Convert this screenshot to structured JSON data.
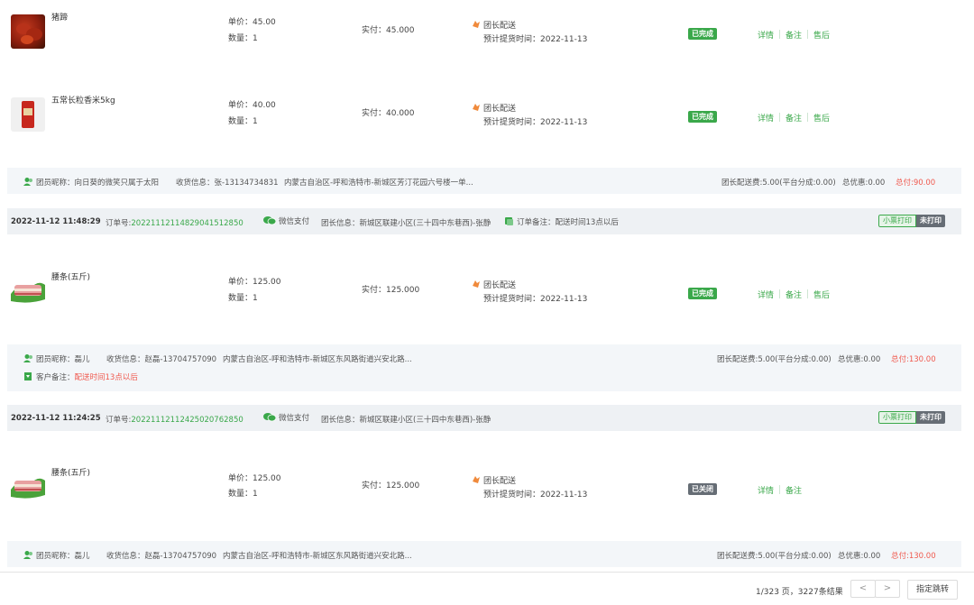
{
  "orders_top": {
    "items": [
      {
        "name": "猪蹄",
        "price": "单价：45.00",
        "qty": "数量：1",
        "paid": "实付：45.000",
        "delivery": "团长配送",
        "pickup": "预计提货时间：2022-11-13",
        "status": "已完成",
        "actions": [
          "详情",
          "备注",
          "售后"
        ]
      },
      {
        "name": "五常长粒香米5kg",
        "price": "单价：40.00",
        "qty": "数量：1",
        "paid": "实付：40.000",
        "delivery": "团长配送",
        "pickup": "预计提货时间：2022-11-13",
        "status": "已完成",
        "actions": [
          "详情",
          "备注",
          "售后"
        ]
      }
    ],
    "summary": {
      "member": "团员昵称：向日葵的微笑只属于太阳",
      "receive": "收货信息：张-13134734831",
      "address": "内蒙古自治区-呼和浩特市-新城区芳汀花园六号楼一单...",
      "fee": "团长配送费:5.00(平台分成:0.00)",
      "discount": "总优惠:0.00",
      "total": "总付:90.00"
    }
  },
  "order2": {
    "header": {
      "datetime": "2022-11-12 11:48:29",
      "order_label": "订单号:",
      "order_no": "2022111211482904151285​0",
      "pay": "微信支付",
      "leader": "团长信息：新城区联建小区(三十四中东巷西)-张静",
      "note": "订单备注：配送时间13点以后",
      "print_btn": "小票打印",
      "print_status": "未打印"
    },
    "item": {
      "name": "腰条(五斤)",
      "price": "单价：125.00",
      "qty": "数量：1",
      "paid": "实付：125.000",
      "delivery": "团长配送",
      "pickup": "预计提货时间：2022-11-13",
      "status": "已完成",
      "actions": [
        "详情",
        "备注",
        "售后"
      ]
    },
    "summary": {
      "member": "团员昵称：磊儿",
      "receive": "收货信息：赵磊-13704757090",
      "address": "内蒙古自治区-呼和浩特市-新城区东风路街道兴安北路...",
      "fee": "团长配送费:5.00(平台分成:0.00)",
      "discount": "总优惠:0.00",
      "total": "总付:130.00",
      "cust_note_label": "客户备注：",
      "cust_note": "配送时间13点以后"
    }
  },
  "order3": {
    "header": {
      "datetime": "2022-11-12 11:24:25",
      "order_label": "订单号:",
      "order_no": "20221112112425020762850",
      "pay": "微信支付",
      "leader": "团长信息：新城区联建小区(三十四中东巷西)-张静",
      "print_btn": "小票打印",
      "print_status": "未打印"
    },
    "item": {
      "name": "腰条(五斤)",
      "price": "单价：125.00",
      "qty": "数量：1",
      "paid": "实付：125.000",
      "delivery": "团长配送",
      "pickup": "预计提货时间：2022-11-13",
      "status": "已关闭",
      "actions": [
        "详情",
        "备注"
      ]
    },
    "summary": {
      "member": "团员昵称：磊儿",
      "receive": "收货信息：赵磊-13704757090",
      "address": "内蒙古自治区-呼和浩特市-新城区东风路街道兴安北路...",
      "fee": "团长配送费:5.00(平台分成:0.00)",
      "discount": "总优惠:0.00",
      "total": "总付:130.00"
    }
  },
  "pagination": {
    "info": "1/323 页，3227条结果",
    "prev": "<",
    "next": ">",
    "jump": "指定跳转"
  },
  "colors": {
    "accent": "#3aa84a",
    "danger": "#f05a4f",
    "closed": "#666d75"
  }
}
